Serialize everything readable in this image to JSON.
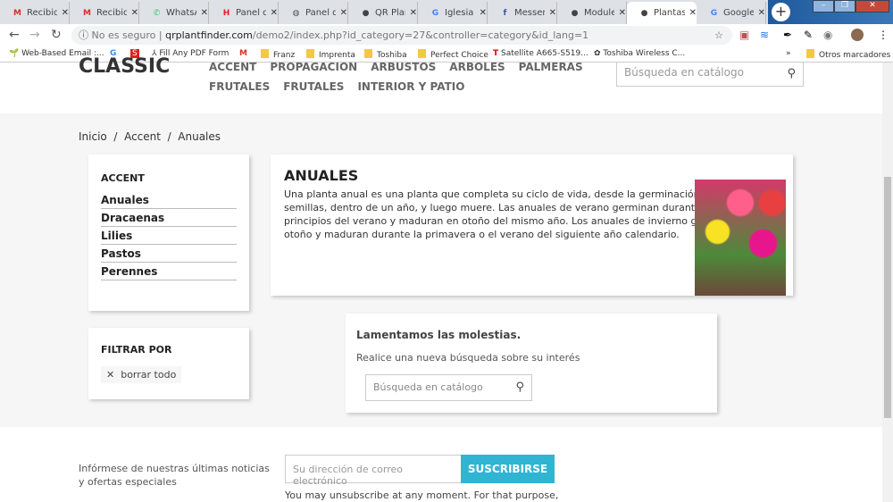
{
  "browser": {
    "tabs": [
      {
        "title": "Recibidos",
        "icon": "gmail-icon",
        "color": "#d93025",
        "glyph": "M"
      },
      {
        "title": "Recibidos",
        "icon": "gmail-icon",
        "color": "#d93025",
        "glyph": "M"
      },
      {
        "title": "WhatsApp",
        "icon": "whatsapp-icon",
        "color": "#25d366",
        "glyph": "✆"
      },
      {
        "title": "Panel de",
        "icon": "h-icon",
        "color": "#e02020",
        "glyph": "H"
      },
      {
        "title": "Panel de",
        "icon": "globe-icon",
        "color": "#555",
        "glyph": "◍"
      },
      {
        "title": "QR Plan",
        "icon": "prestashop-icon",
        "color": "#444",
        "glyph": "●"
      },
      {
        "title": "Iglesia d",
        "icon": "google-icon",
        "color": "#4285f4",
        "glyph": "G"
      },
      {
        "title": "Messen",
        "icon": "facebook-icon",
        "color": "#3b5998",
        "glyph": "f"
      },
      {
        "title": "Module",
        "icon": "prestashop-icon",
        "color": "#444",
        "glyph": "●"
      },
      {
        "title": "Plantas",
        "icon": "prestashop-icon",
        "color": "#444",
        "glyph": "●",
        "active": true
      },
      {
        "title": "Google",
        "icon": "google-translate-icon",
        "color": "#4285f4",
        "glyph": "G"
      }
    ],
    "security_label": "No es seguro",
    "url_domain": "qrplantfinder.com",
    "url_path": "/demo2/index.php?id_category=27&controller=category&id_lang=1",
    "bookmarks": [
      "Web-Based Email :...",
      "Fill Any PDF Form",
      "Franz",
      "Imprenta",
      "Toshiba",
      "Perfect Choice",
      "Satellite A665-S519...",
      "Toshiba Wireless C..."
    ],
    "other_bookmarks": "Otros marcadores"
  },
  "header": {
    "logo": "CLASSIC",
    "menu_row1": [
      "ACCENT",
      "PROPAGACION",
      "ARBUSTOS",
      "ARBOLES",
      "PALMERAS"
    ],
    "menu_row2": [
      "FRUTALES",
      "FRUTALES",
      "INTERIOR Y PATIO"
    ],
    "search_placeholder": "Búsqueda en catálogo"
  },
  "breadcrumb": [
    "Inicio",
    "Accent",
    "Anuales"
  ],
  "sidebar": {
    "title": "ACCENT",
    "items": [
      "Anuales",
      "Dracaenas",
      "Lilies",
      "Pastos",
      "Perennes"
    ],
    "filter_title": "FILTRAR POR",
    "clear_all": "borrar todo"
  },
  "category": {
    "title": "ANUALES",
    "lines": [
      "Una planta anual es una planta que completa su ciclo de vida, desde la germinación hasta",
      "semillas, dentro de un año, y luego muere. Las anuales de verano germinan durante la pri",
      "principios del verano y maduran en otoño del mismo año. Los anuales de invierno germin",
      "otoño y maduran durante la primavera o el verano del siguiente año calendario."
    ]
  },
  "no_results": {
    "title": "Lamentamos las molestias.",
    "text": "Realice una nueva búsqueda sobre su interés",
    "search_placeholder": "Búsqueda en catálogo"
  },
  "newsletter": {
    "text": "Infórmese de nuestras últimas noticias y ofertas especiales",
    "email_placeholder": "Su dirección de correo electrónico",
    "button": "SUSCRIBIRSE",
    "note": "You may unsubscribe at any moment. For that purpose,"
  },
  "colors": {
    "accent": "#2fb5d2",
    "page_bg": "#f6f6f6"
  }
}
